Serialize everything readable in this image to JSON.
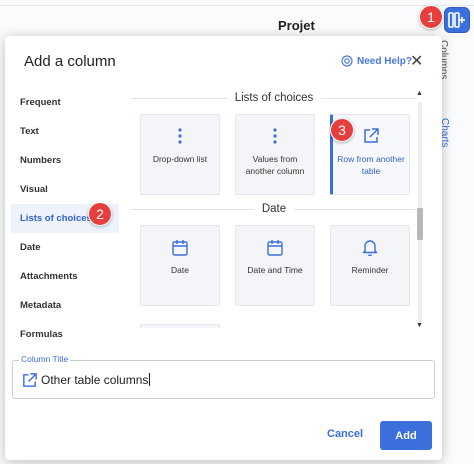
{
  "background": {
    "page_title": "Projet",
    "right_tab_columns": "Columns",
    "right_tab_charts": "Charts"
  },
  "badges": [
    "1",
    "2",
    "3"
  ],
  "dialog": {
    "title": "Add a column",
    "help_label": "Need Help?",
    "categories": [
      {
        "label": "Frequent"
      },
      {
        "label": "Text"
      },
      {
        "label": "Numbers"
      },
      {
        "label": "Visual"
      },
      {
        "label": "Lists of choices",
        "active": true
      },
      {
        "label": "Date"
      },
      {
        "label": "Attachments"
      },
      {
        "label": "Metadata"
      },
      {
        "label": "Formulas"
      }
    ],
    "sections": [
      {
        "title": "Lists of choices",
        "options": [
          {
            "label": "Drop-down list",
            "icon": "vertical-dots-icon"
          },
          {
            "label": "Values from another column",
            "icon": "vertical-dots-icon"
          },
          {
            "label": "Row from another table",
            "icon": "external-link-icon",
            "selected": true
          }
        ]
      },
      {
        "title": "Date",
        "options": [
          {
            "label": "Date",
            "icon": "calendar-icon"
          },
          {
            "label": "Date and Time",
            "icon": "calendar-icon"
          },
          {
            "label": "Reminder",
            "icon": "bell-icon"
          }
        ]
      }
    ],
    "column_title": {
      "legend": "Column Title",
      "value": "Other table columns"
    },
    "cancel_label": "Cancel",
    "add_label": "Add"
  },
  "colors": {
    "accent": "#3b6fdc",
    "badge": "#e63d3d",
    "card_bg": "#f3f5f8"
  }
}
